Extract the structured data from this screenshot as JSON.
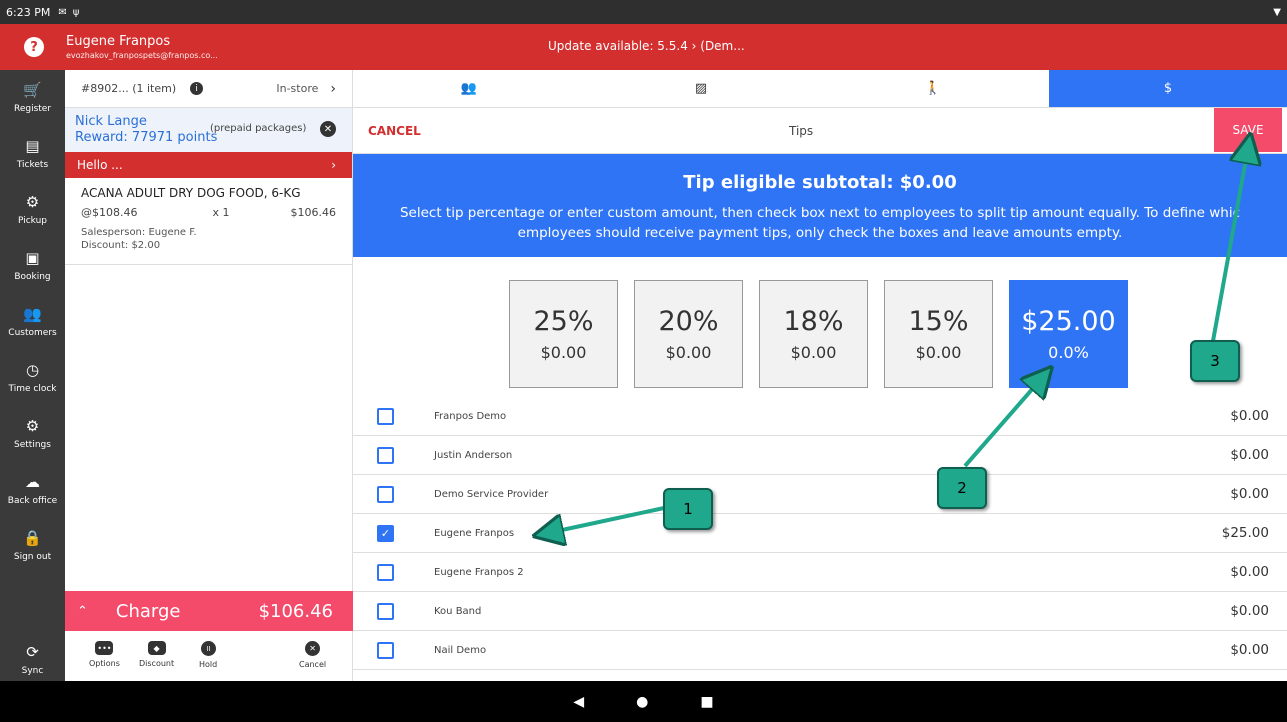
{
  "status": {
    "time": "6:23 PM"
  },
  "header": {
    "user_name": "Eugene Franpos",
    "user_email": "evozhakov_franpospets@franpos.co...",
    "update": "Update available: 5.5.4 › (Dem..."
  },
  "sidebar": {
    "items": [
      {
        "label": "Register",
        "icon": "🛒"
      },
      {
        "label": "Tickets",
        "icon": "▤"
      },
      {
        "label": "Pickup",
        "icon": "⚙"
      },
      {
        "label": "Booking",
        "icon": "▣"
      },
      {
        "label": "Customers",
        "icon": "👥"
      },
      {
        "label": "Time clock",
        "icon": "◷"
      },
      {
        "label": "Settings",
        "icon": "⚙"
      },
      {
        "label": "Back office",
        "icon": "☁"
      },
      {
        "label": "Sign out",
        "icon": "🔒"
      }
    ],
    "sync": "Sync"
  },
  "cart": {
    "order": "#8902... (1 item)",
    "order_type": "In-store",
    "customer_name": "Nick Lange",
    "reward": "Reward: 77971 points",
    "prepaid": "(prepaid packages)",
    "hello": "Hello ...",
    "item": {
      "title": "ACANA ADULT DRY DOG FOOD, 6-KG",
      "unit_price": "@$108.46",
      "qty": "x  1",
      "amount": "$106.46",
      "salesperson": "Salesperson: Eugene F.",
      "discount": "Discount: $2.00"
    },
    "charge_label": "Charge",
    "charge_total": "$106.46",
    "actions": [
      "Options",
      "Discount",
      "Hold",
      "Cancel"
    ]
  },
  "tips": {
    "cancel": "CANCEL",
    "title": "Tips",
    "save": "SAVE",
    "subtotal": "Tip eligible subtotal: $0.00",
    "description": "Select tip percentage or enter custom amount, then check box next to employees to split tip amount equally. To define which employees should receive payment tips, only check the boxes and leave amounts empty.",
    "description_line1": "Select tip percentage or enter custom amount, then check box next to employees to split tip amount equally. To define whic",
    "description_line2": "employees should receive payment tips, only check the boxes and leave amounts empty.",
    "options": [
      {
        "pct": "25%",
        "val": "$0.00"
      },
      {
        "pct": "20%",
        "val": "$0.00"
      },
      {
        "pct": "18%",
        "val": "$0.00"
      },
      {
        "pct": "15%",
        "val": "$0.00"
      },
      {
        "pct": "$25.00",
        "val": "0.0%"
      }
    ],
    "employees": [
      {
        "name": "Franpos Demo",
        "amount": "$0.00",
        "checked": false
      },
      {
        "name": "Justin Anderson",
        "amount": "$0.00",
        "checked": false
      },
      {
        "name": "Demo Service Provider",
        "amount": "$0.00",
        "checked": false
      },
      {
        "name": "Eugene Franpos",
        "amount": "$25.00",
        "checked": true
      },
      {
        "name": "Eugene Franpos 2",
        "amount": "$0.00",
        "checked": false
      },
      {
        "name": "Kou Band",
        "amount": "$0.00",
        "checked": false
      },
      {
        "name": "Nail Demo",
        "amount": "$0.00",
        "checked": false
      }
    ]
  },
  "annotations": {
    "callout1": "1",
    "callout2": "2",
    "callout3": "3"
  },
  "colors": {
    "brand_red": "#d32f2f",
    "accent_blue": "#2f74f5",
    "charge_pink": "#f44b6b",
    "callout_green": "#1fa88b"
  }
}
